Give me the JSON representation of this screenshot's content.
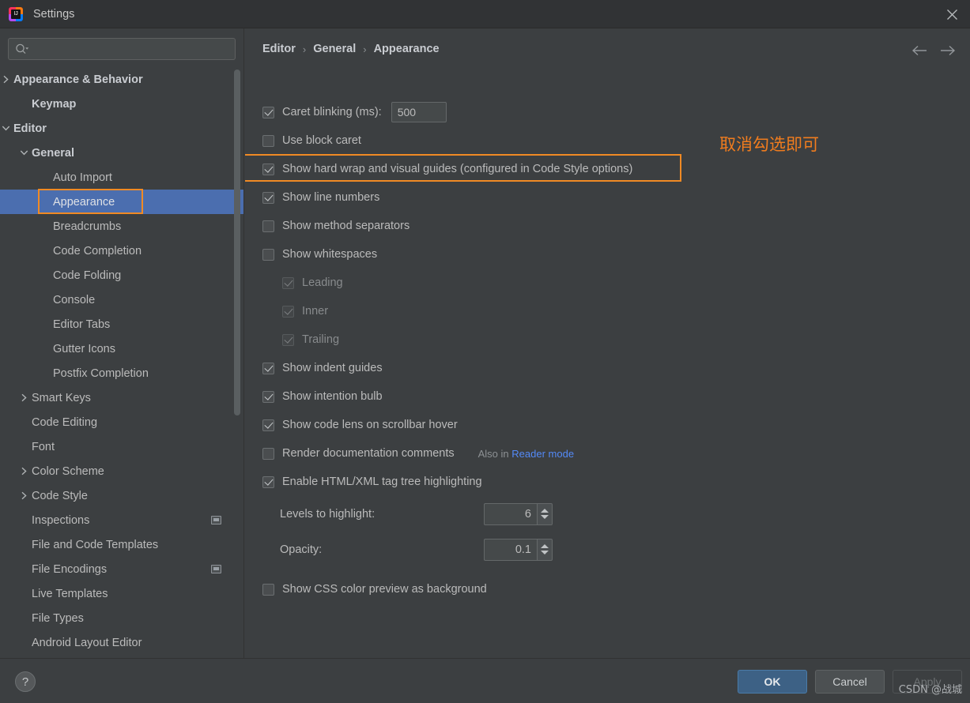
{
  "window": {
    "title": "Settings",
    "app_icon": "intellij-idea-logo",
    "close_icon": "close-icon"
  },
  "sidebar": {
    "search": {
      "placeholder": "",
      "value": "",
      "icon": "search-icon"
    },
    "items": [
      {
        "label": "Appearance & Behavior",
        "depth": 0,
        "arrow": "collapsed",
        "bold": true,
        "selected": false,
        "badge": false
      },
      {
        "label": "Keymap",
        "depth": 1,
        "arrow": "none",
        "bold": true,
        "selected": false,
        "badge": false
      },
      {
        "label": "Editor",
        "depth": 0,
        "arrow": "expanded",
        "bold": true,
        "selected": false,
        "badge": false
      },
      {
        "label": "General",
        "depth": 1,
        "arrow": "expanded",
        "bold": true,
        "selected": false,
        "badge": false
      },
      {
        "label": "Auto Import",
        "depth": 2,
        "arrow": "none",
        "bold": false,
        "selected": false,
        "badge": false
      },
      {
        "label": "Appearance",
        "depth": 2,
        "arrow": "none",
        "bold": false,
        "selected": true,
        "badge": false
      },
      {
        "label": "Breadcrumbs",
        "depth": 2,
        "arrow": "none",
        "bold": false,
        "selected": false,
        "badge": false
      },
      {
        "label": "Code Completion",
        "depth": 2,
        "arrow": "none",
        "bold": false,
        "selected": false,
        "badge": false
      },
      {
        "label": "Code Folding",
        "depth": 2,
        "arrow": "none",
        "bold": false,
        "selected": false,
        "badge": false
      },
      {
        "label": "Console",
        "depth": 2,
        "arrow": "none",
        "bold": false,
        "selected": false,
        "badge": false
      },
      {
        "label": "Editor Tabs",
        "depth": 2,
        "arrow": "none",
        "bold": false,
        "selected": false,
        "badge": false
      },
      {
        "label": "Gutter Icons",
        "depth": 2,
        "arrow": "none",
        "bold": false,
        "selected": false,
        "badge": false
      },
      {
        "label": "Postfix Completion",
        "depth": 2,
        "arrow": "none",
        "bold": false,
        "selected": false,
        "badge": false
      },
      {
        "label": "Smart Keys",
        "depth": 1,
        "arrow": "collapsed",
        "bold": false,
        "selected": false,
        "badge": false
      },
      {
        "label": "Code Editing",
        "depth": 1,
        "arrow": "none",
        "bold": false,
        "selected": false,
        "badge": false
      },
      {
        "label": "Font",
        "depth": 1,
        "arrow": "none",
        "bold": false,
        "selected": false,
        "badge": false
      },
      {
        "label": "Color Scheme",
        "depth": 1,
        "arrow": "collapsed",
        "bold": false,
        "selected": false,
        "badge": false
      },
      {
        "label": "Code Style",
        "depth": 1,
        "arrow": "collapsed",
        "bold": false,
        "selected": false,
        "badge": false
      },
      {
        "label": "Inspections",
        "depth": 1,
        "arrow": "none",
        "bold": false,
        "selected": false,
        "badge": true
      },
      {
        "label": "File and Code Templates",
        "depth": 1,
        "arrow": "none",
        "bold": false,
        "selected": false,
        "badge": false
      },
      {
        "label": "File Encodings",
        "depth": 1,
        "arrow": "none",
        "bold": false,
        "selected": false,
        "badge": true
      },
      {
        "label": "Live Templates",
        "depth": 1,
        "arrow": "none",
        "bold": false,
        "selected": false,
        "badge": false
      },
      {
        "label": "File Types",
        "depth": 1,
        "arrow": "none",
        "bold": false,
        "selected": false,
        "badge": false
      },
      {
        "label": "Android Layout Editor",
        "depth": 1,
        "arrow": "none",
        "bold": false,
        "selected": false,
        "badge": false
      }
    ]
  },
  "main": {
    "breadcrumb": [
      "Editor",
      "General",
      "Appearance"
    ],
    "breadcrumb_separator": "›",
    "nav": {
      "back_icon": "arrow-left-icon",
      "forward_icon": "arrow-right-icon"
    },
    "caret_blinking": {
      "label": "Caret blinking (ms):",
      "checked": true,
      "value": "500"
    },
    "options": [
      {
        "label": "Use block caret",
        "checked": false,
        "enabled": true,
        "indent": false
      },
      {
        "label": "Show hard wrap and visual guides (configured in Code Style options)",
        "checked": true,
        "enabled": true,
        "indent": false,
        "highlighted": true
      },
      {
        "label": "Show line numbers",
        "checked": true,
        "enabled": true,
        "indent": false
      },
      {
        "label": "Show method separators",
        "checked": false,
        "enabled": true,
        "indent": false
      },
      {
        "label": "Show whitespaces",
        "checked": false,
        "enabled": true,
        "indent": false
      },
      {
        "label": "Leading",
        "checked": true,
        "enabled": false,
        "indent": true
      },
      {
        "label": "Inner",
        "checked": true,
        "enabled": false,
        "indent": true
      },
      {
        "label": "Trailing",
        "checked": true,
        "enabled": false,
        "indent": true
      },
      {
        "label": "Show indent guides",
        "checked": true,
        "enabled": true,
        "indent": false
      },
      {
        "label": "Show intention bulb",
        "checked": true,
        "enabled": true,
        "indent": false
      },
      {
        "label": "Show code lens on scrollbar hover",
        "checked": true,
        "enabled": true,
        "indent": false
      }
    ],
    "render_doc": {
      "label": "Render documentation comments",
      "checked": false,
      "also_in_prefix": "Also in",
      "also_in_link": "Reader mode"
    },
    "html_highlight": {
      "label": "Enable HTML/XML tag tree highlighting",
      "checked": true
    },
    "levels": {
      "label": "Levels to highlight:",
      "value": "6"
    },
    "opacity": {
      "label": "Opacity:",
      "value": "0.1"
    },
    "css_preview": {
      "label": "Show CSS color preview as background",
      "checked": false
    },
    "annotation": "取消勾选即可",
    "accent_color": "#f08a24"
  },
  "footer": {
    "help_label": "?",
    "ok_label": "OK",
    "cancel_label": "Cancel",
    "apply_label": "Apply",
    "watermark": "CSDN @战城"
  }
}
